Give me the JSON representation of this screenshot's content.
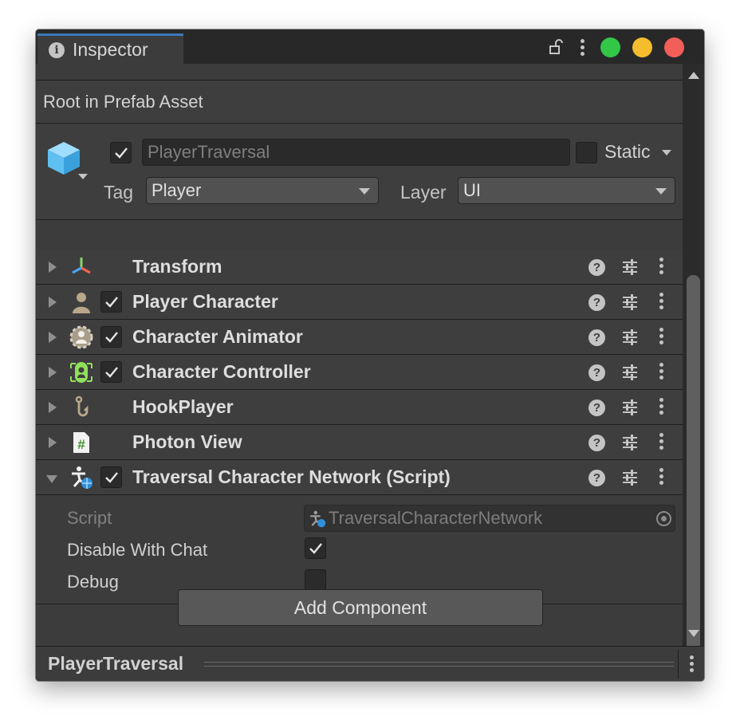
{
  "window": {
    "tab_label": "Inspector",
    "tab_icon": "info-icon",
    "traffic_lights": [
      "#33c748",
      "#f5bd2e",
      "#f25f58"
    ]
  },
  "prefab_bar": {
    "text": "Root in Prefab Asset"
  },
  "header": {
    "active": true,
    "name": "PlayerTraversal",
    "static_checked": false,
    "static_label": "Static",
    "tag_label": "Tag",
    "tag_value": "Player",
    "layer_label": "Layer",
    "layer_value": "UI"
  },
  "components": [
    {
      "name": "Transform",
      "icon": "transform-axes-icon",
      "has_toggle": false,
      "expanded": false
    },
    {
      "name": "Player Character",
      "icon": "person-icon",
      "has_toggle": true,
      "checked": true,
      "expanded": false
    },
    {
      "name": "Character Animator",
      "icon": "animator-gear-icon",
      "has_toggle": true,
      "checked": true,
      "expanded": false
    },
    {
      "name": "Character Controller",
      "icon": "capsule-collider-icon",
      "has_toggle": true,
      "checked": true,
      "expanded": false
    },
    {
      "name": "HookPlayer",
      "icon": "hook-icon",
      "has_toggle": false,
      "expanded": false
    },
    {
      "name": "Photon View",
      "icon": "csharp-script-icon",
      "has_toggle": false,
      "expanded": false
    },
    {
      "name": "Traversal Character Network (Script)",
      "icon": "traversal-network-icon",
      "has_toggle": true,
      "checked": true,
      "expanded": true
    }
  ],
  "script_fields": {
    "script_label": "Script",
    "script_value": "TraversalCharacterNetwork",
    "disable_with_chat_label": "Disable With Chat",
    "disable_with_chat": true,
    "debug_label": "Debug",
    "debug": false
  },
  "add_component_label": "Add Component",
  "footer": {
    "name": "PlayerTraversal"
  }
}
